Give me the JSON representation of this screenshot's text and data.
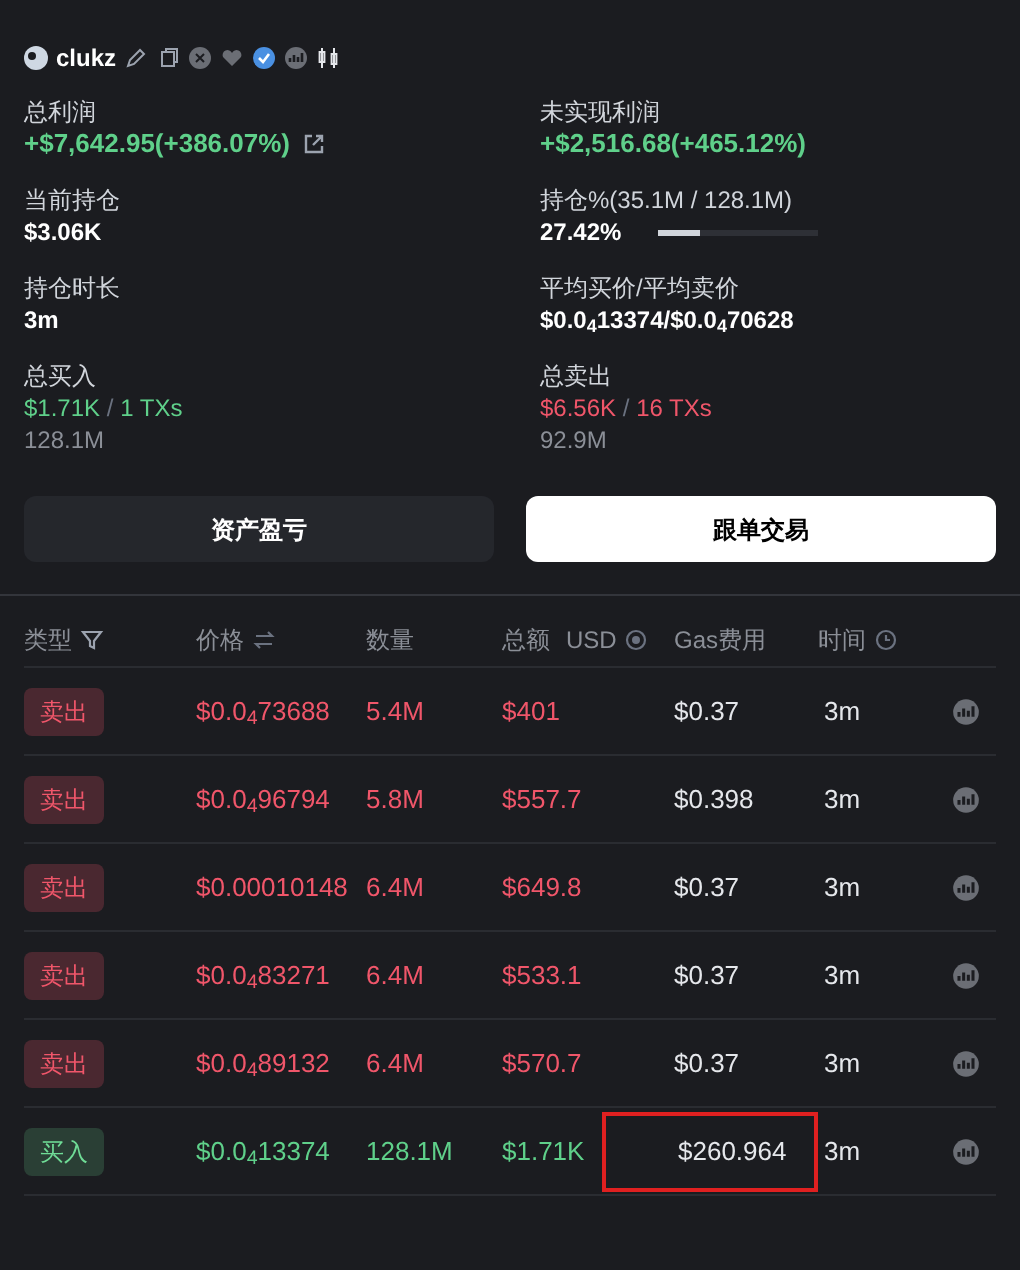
{
  "profile": {
    "name": "clukz"
  },
  "stats": [
    {
      "label": "总利润",
      "value": "+$7,642.95(+386.07%)",
      "kind": "profit"
    },
    {
      "label": "未实现利润",
      "value": "+$2,516.68(+465.12%)",
      "kind": "profit"
    },
    {
      "label": "当前持仓",
      "value": "$3.06K",
      "kind": "plain"
    },
    {
      "label": "持仓%(35.1M / 128.1M)",
      "value": "27.42%",
      "kind": "meter",
      "level": 0.27
    },
    {
      "label": "持仓时长",
      "value": "3m",
      "kind": "plain"
    },
    {
      "label": "平均买价/平均卖价",
      "value": "$0.0$_{4}$13374/$0.0$_{4}$70628",
      "kind": "plain"
    },
    {
      "label": "总买入",
      "value": "$1.71K",
      "separator": "/",
      "txs": "1 TXs",
      "sub": "128.1M",
      "kind": "buy"
    },
    {
      "label": "总卖出",
      "value": "$6.56K",
      "separator": "/",
      "txs": "16 TXs",
      "sub": "92.9M",
      "kind": "sell"
    }
  ],
  "buttons": [
    {
      "label": "资产盈亏",
      "selected": false
    },
    {
      "label": "跟单交易",
      "selected": true
    }
  ],
  "table": {
    "columns": [
      {
        "label": "类型"
      },
      {
        "label": "价格"
      },
      {
        "label": "数量"
      },
      {
        "label": "总额",
        "unit": "USD"
      },
      {
        "label": "Gas费用"
      },
      {
        "label": "时间"
      }
    ],
    "rows": [
      {
        "type": "卖出",
        "kind": "sell",
        "price": "$0.0$_{4}$73688",
        "amount": "5.4M",
        "total": "$401",
        "gas": "$0.37",
        "time": "3m",
        "highlighted": false
      },
      {
        "type": "卖出",
        "kind": "sell",
        "price": "$0.0$_{4}$96794",
        "amount": "5.8M",
        "total": "$557.7",
        "gas": "$0.398",
        "time": "3m",
        "highlighted": false
      },
      {
        "type": "卖出",
        "kind": "sell",
        "price": "$0.00010148",
        "amount": "6.4M",
        "total": "$649.8",
        "gas": "$0.37",
        "time": "3m",
        "highlighted": false
      },
      {
        "type": "卖出",
        "kind": "sell",
        "price": "$0.0$_{4}$83271",
        "amount": "6.4M",
        "total": "$533.1",
        "gas": "$0.37",
        "time": "3m",
        "highlighted": false
      },
      {
        "type": "卖出",
        "kind": "sell",
        "price": "$0.0$_{4}$89132",
        "amount": "6.4M",
        "total": "$570.7",
        "gas": "$0.37",
        "time": "3m",
        "highlighted": false
      },
      {
        "type": "买入",
        "kind": "buy",
        "price": "$0.0$_{4}$13374",
        "amount": "128.1M",
        "total": "$1.71K",
        "gas": "$260.964",
        "time": "3m",
        "highlighted": true
      }
    ]
  }
}
